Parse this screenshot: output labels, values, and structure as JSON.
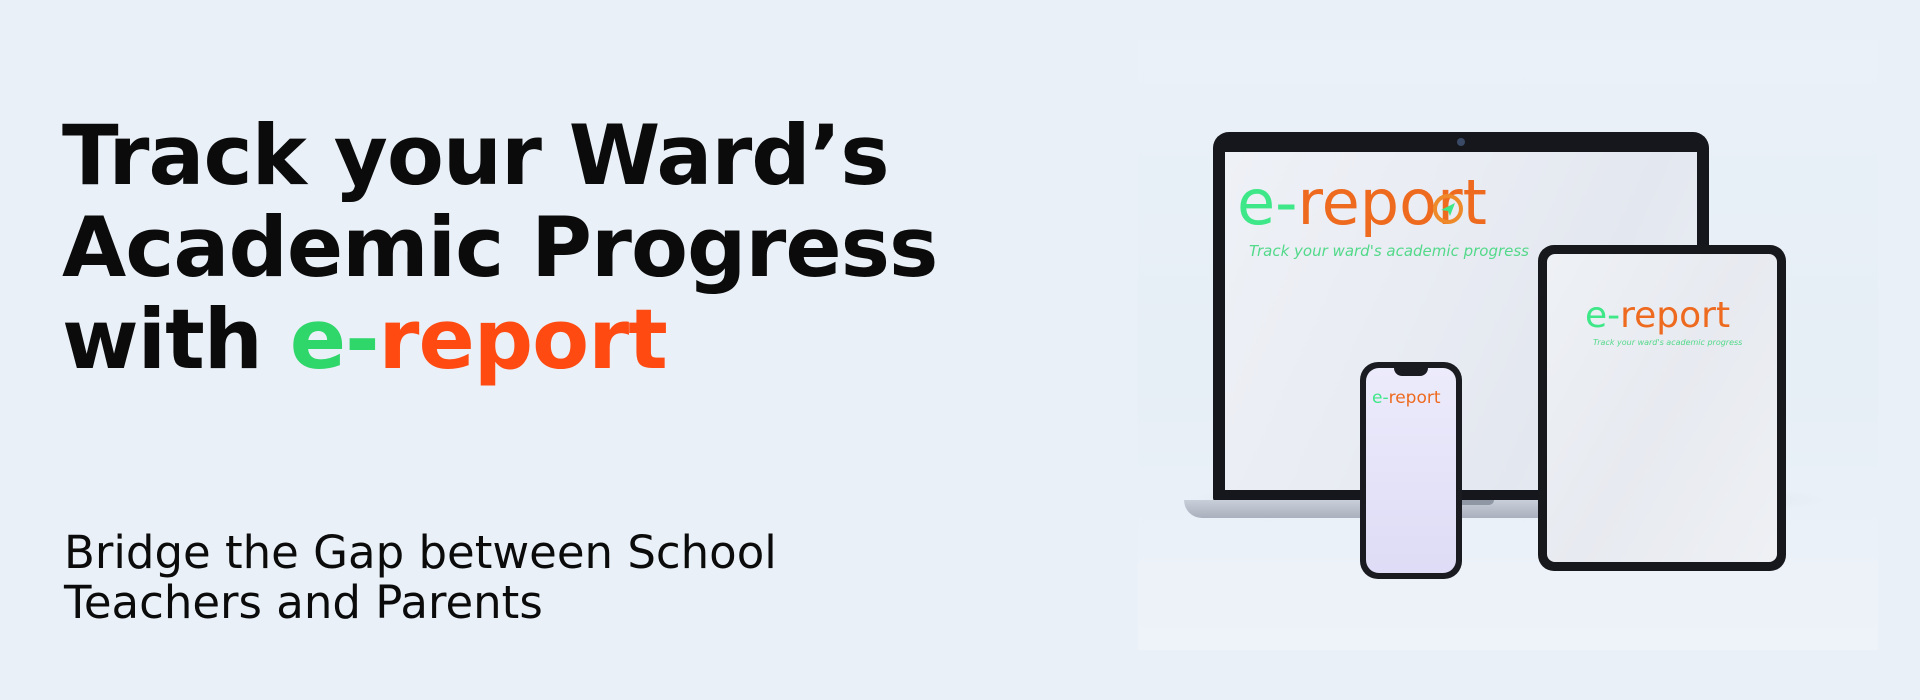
{
  "headline": {
    "line1": "Track your Ward’s",
    "line2": "Academic Progress",
    "line3_prefix": "with ",
    "brand_e": "e-",
    "brand_rest": "report"
  },
  "subtitle": {
    "line1": "Bridge the Gap between School",
    "line2": "Teachers and Parents"
  },
  "devices": {
    "laptop": {
      "logo_e": "e-",
      "logo_rest": "report",
      "tagline": "Track your ward's academic progress"
    },
    "tablet": {
      "logo_e": "e-",
      "logo_rest": "report",
      "tagline": "Track your ward's academic progress"
    },
    "phone": {
      "logo_e": "e-",
      "logo_rest": "report"
    }
  },
  "colors": {
    "brand_green": "#2fd66a",
    "brand_orange": "#ff4a12",
    "background": "#e9f0f7",
    "text": "#0b0b0b"
  },
  "icons": [
    "paper-plane-icon"
  ]
}
